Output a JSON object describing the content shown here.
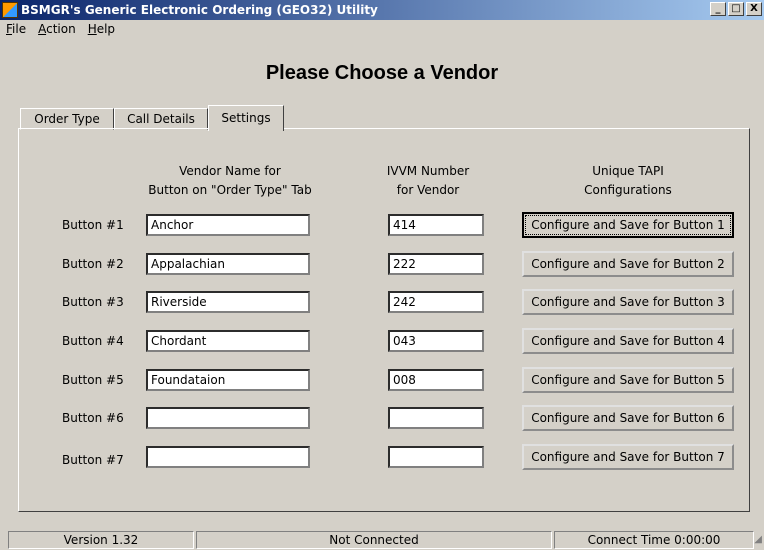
{
  "window": {
    "title": "BSMGR's Generic Electronic Ordering (GEO32) Utility",
    "controls": [
      "_",
      "□",
      "X"
    ]
  },
  "menu": [
    "File",
    "Action",
    "Help"
  ],
  "page_title": "Please Choose a Vendor",
  "tabs": [
    {
      "label": "Order Type",
      "active": false
    },
    {
      "label": "Call Details",
      "active": false
    },
    {
      "label": "Settings",
      "active": true
    }
  ],
  "headers": {
    "vendor_name": [
      "Vendor Name for",
      "Button on \"Order Type\" Tab"
    ],
    "ivvm_number": [
      "IVVM Number",
      "for Vendor"
    ],
    "tapi": [
      "Unique TAPI",
      "Configurations"
    ]
  },
  "rows": [
    {
      "label": "Button #1",
      "vendor": "Anchor",
      "number": "414",
      "button": "Configure and Save for Button 1"
    },
    {
      "label": "Button #2",
      "vendor": "Appalachian",
      "number": "222",
      "button": "Configure and Save for Button 2"
    },
    {
      "label": "Button #3",
      "vendor": "Riverside",
      "number": "242",
      "button": "Configure and Save for Button 3"
    },
    {
      "label": "Button #4",
      "vendor": "Chordant",
      "number": "043",
      "button": "Configure and Save for Button 4"
    },
    {
      "label": "Button #5",
      "vendor": "Foundataion",
      "number": "008",
      "button": "Configure and Save for Button 5"
    },
    {
      "label": "Button #6",
      "vendor": "",
      "number": "",
      "button": "Configure and Save for Button 6"
    },
    {
      "label": "Button #7",
      "vendor": "",
      "number": "",
      "button": "Configure and Save for Button 7"
    }
  ],
  "status": {
    "version": "Version 1.32",
    "connection": "Not Connected",
    "connect_time": "Connect Time 0:00:00"
  }
}
